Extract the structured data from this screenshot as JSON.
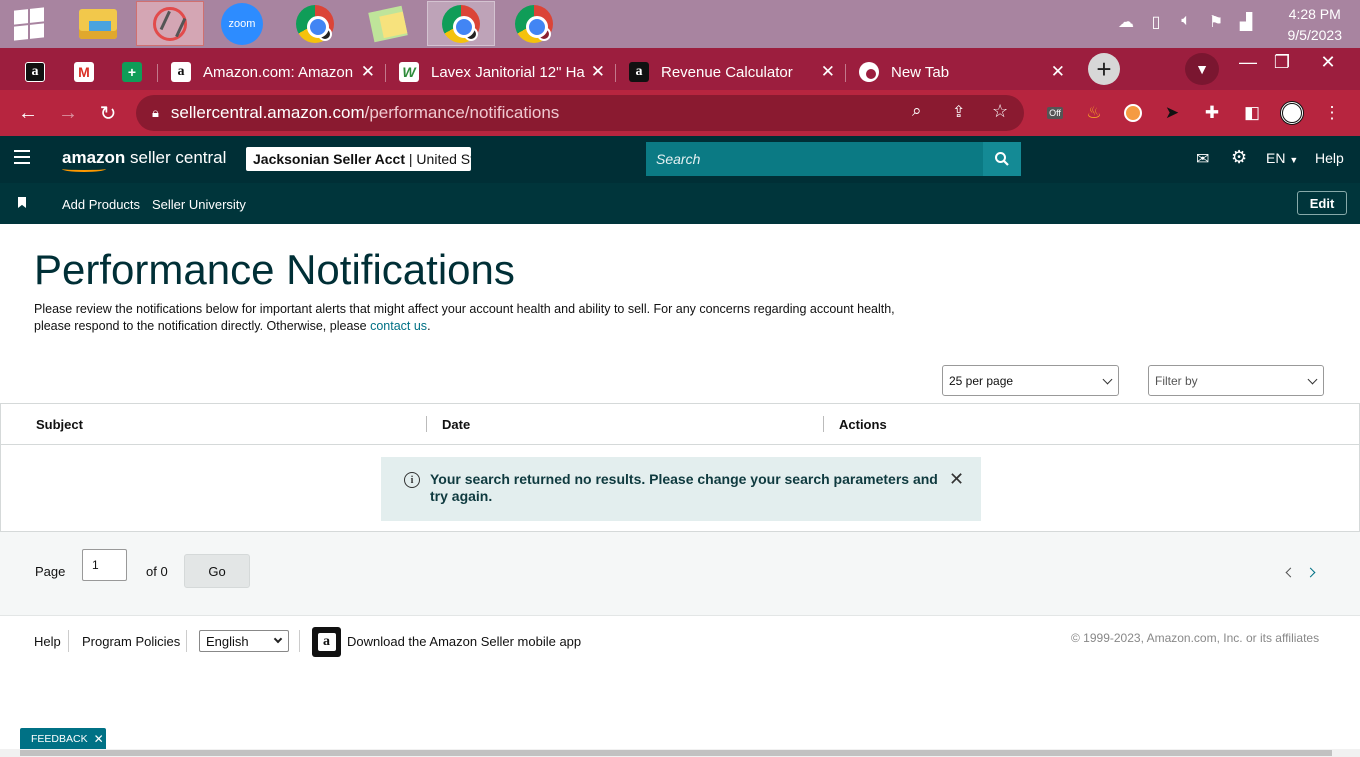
{
  "taskbar": {
    "apps": [
      {
        "name": "File Explorer",
        "icon": "folder-icon"
      },
      {
        "name": "Snipping Tool",
        "icon": "snipping-tool-icon"
      },
      {
        "name": "Zoom",
        "label": "zoom",
        "icon": "zoom-icon"
      },
      {
        "name": "Chrome profile 1",
        "icon": "chrome-icon"
      },
      {
        "name": "Sticky Notes",
        "icon": "sticky-notes-icon"
      },
      {
        "name": "Chrome profile 2",
        "icon": "chrome-icon"
      },
      {
        "name": "Chrome profile 3",
        "icon": "chrome-icon"
      }
    ],
    "clock": {
      "time": "4:28 PM",
      "date": "9/5/2023"
    }
  },
  "browser": {
    "tabs": [
      {
        "title": "Amazon.com: Amazon",
        "favicon": "amazon-icon"
      },
      {
        "title": "Lavex Janitorial 12\" Ha",
        "favicon": "lavex-icon"
      },
      {
        "title": "Revenue Calculator",
        "favicon": "amazon-icon"
      },
      {
        "title": "New Tab",
        "favicon": "chrome-icon"
      }
    ],
    "pinned_letters": {
      "amazon": "a",
      "gmail": "M",
      "sheets": "+"
    },
    "url_host": "sellercentral.amazon.com",
    "url_path": "/performance/notifications",
    "extension_badge": "Off"
  },
  "sc_header": {
    "logo_brand": "amazon",
    "logo_suffix": " seller central",
    "account_name": "Jacksonian Seller Acct",
    "account_region": " | United States",
    "search_placeholder": "Search",
    "language": "EN",
    "help": "Help"
  },
  "sc_nav": {
    "links": [
      "Add Products",
      "Seller University"
    ],
    "edit": "Edit"
  },
  "main": {
    "title": "Performance Notifications",
    "intro_text": "Please review the notifications below for important alerts that might affect your account health and ability to sell. For any concerns regarding account health, please respond to the notification directly. Otherwise, please ",
    "intro_link": "contact us",
    "intro_end": ".",
    "per_page": "25 per page",
    "filter_placeholder": "Filter by",
    "columns": [
      "Subject",
      "Date",
      "Actions"
    ],
    "empty_message": "Your search returned no results. Please change your search parameters and try again.",
    "pagination": {
      "page_label": "Page",
      "current_page": "1",
      "of_label": "of 0",
      "go": "Go"
    }
  },
  "footer": {
    "links": [
      "Help",
      "Program Policies"
    ],
    "language": "English",
    "app_text": "Download the Amazon Seller mobile app",
    "copyright": "© 1999-2023, Amazon.com, Inc. or its affiliates",
    "feedback": "FEEDBACK"
  },
  "colors": {
    "taskbar": "#a884a0",
    "tabstrip": "#9c1e3e",
    "toolbar": "#b7253f",
    "sc_header": "#002f36",
    "sc_nav": "#00353b",
    "link": "#007185",
    "alert_bg": "#e3eeee"
  }
}
